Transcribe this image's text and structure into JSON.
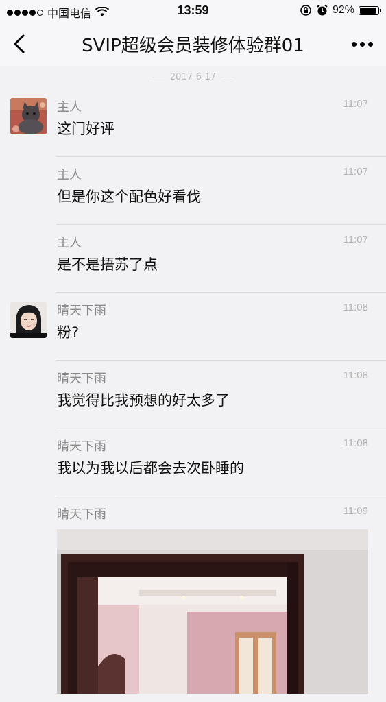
{
  "status_bar": {
    "carrier": "中国电信",
    "time": "13:59",
    "battery_percent": "92%",
    "battery_level": 0.92,
    "signal_bars": 4
  },
  "nav": {
    "title": "SVIP超级会员装修体验群01",
    "back_icon": "chevron-left-icon",
    "more_icon": "more-dots-icon"
  },
  "date_separator": "2017-6-17",
  "messages": [
    {
      "sender": "主人",
      "time": "11:07",
      "text": "这门好评",
      "avatar": "cat-avatar"
    },
    {
      "sender": "主人",
      "time": "11:07",
      "text": "但是你这个配色好看伐"
    },
    {
      "sender": "主人",
      "time": "11:07",
      "text": "是不是捂苏了点"
    },
    {
      "sender": "晴天下雨",
      "time": "11:08",
      "text": "粉?",
      "avatar": "person-avatar"
    },
    {
      "sender": "晴天下雨",
      "time": "11:08",
      "text": "我觉得比我预想的好太多了"
    },
    {
      "sender": "晴天下雨",
      "time": "11:08",
      "text": "我以为我以后都会去次卧睡的"
    }
  ],
  "image_message": {
    "sender": "晴天下雨",
    "time": "11:09"
  },
  "colors": {
    "background": "#f2f2f4",
    "name_gray": "#8a8a8a",
    "time_gray": "#b4b4b4",
    "door_frame": "#3a1e1c",
    "wall_pink": "#d8a8b0"
  }
}
